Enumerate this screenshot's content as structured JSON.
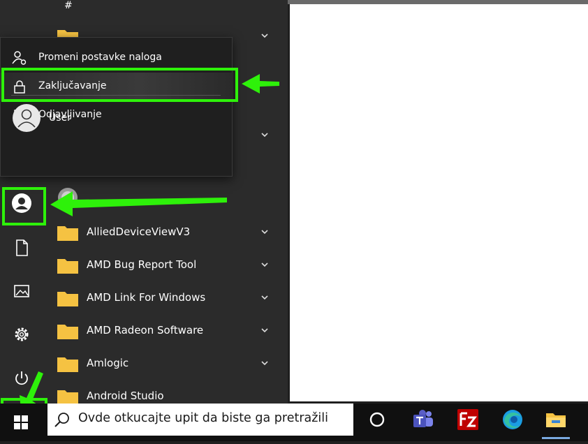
{
  "menu": {
    "hash": "#",
    "apps": [
      {
        "name": "AlliedDeviceViewV3"
      },
      {
        "name": "AMD Bug Report Tool"
      },
      {
        "name": "AMD Link For Windows"
      },
      {
        "name": "AMD Radeon Software"
      },
      {
        "name": "Amlogic"
      },
      {
        "name": "Android Studio"
      }
    ]
  },
  "flyout": {
    "items": [
      {
        "label": "Promeni postavke naloga",
        "icon": "account-settings-icon"
      },
      {
        "label": "Zaključavanje",
        "icon": "lock-icon"
      },
      {
        "label": "Odjavljivanje",
        "icon": "sign-out-icon"
      }
    ],
    "user": {
      "label": "User"
    }
  },
  "taskbar": {
    "search_placeholder": "Ovde otkucajte upit da biste ga pretražili",
    "icons": [
      "cortana-icon",
      "teams-icon",
      "filezilla-icon",
      "edge-icon",
      "file-explorer-icon"
    ]
  },
  "colors": {
    "highlight": "#2ef10a",
    "folder": "#f5c242",
    "menu_bg": "#2b2b2b",
    "flyout_bg": "#1f1f1f"
  }
}
